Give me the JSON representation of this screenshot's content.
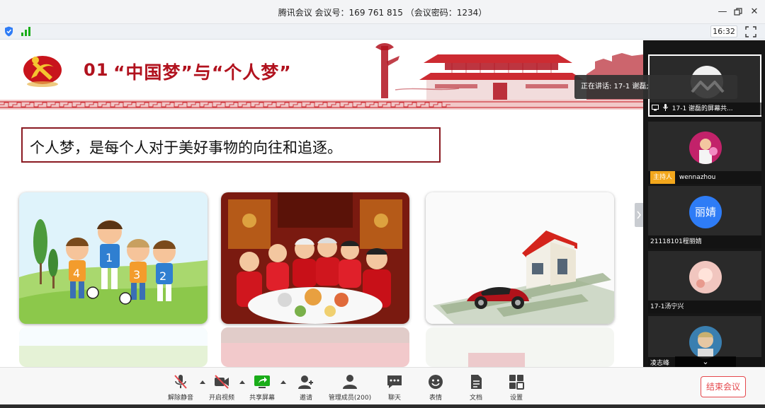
{
  "window": {
    "title": "腾讯会议 会议号：169 761 815 （会议密码：1234）",
    "controls": [
      "minimize-icon",
      "restore-icon",
      "close-icon"
    ]
  },
  "status": {
    "time": "16:32",
    "icons": [
      "shield-icon",
      "signal-icon",
      "fullscreen-icon"
    ]
  },
  "slide": {
    "number": "01",
    "title": "“中国梦”与“个人梦”",
    "quote": "个人梦，是每个人对于美好事物的向往和追逐。",
    "images": [
      "children-soccer-image",
      "family-reunion-dinner-image",
      "house-car-money-image"
    ]
  },
  "participants": {
    "speaking_label": "正在讲话: 17-1  谢磊;",
    "tiles": [
      {
        "name": "17-1  谢磊的屏幕共...",
        "active": true
      },
      {
        "badge": "主持人",
        "name": "wennazhou"
      },
      {
        "avatar_text": "丽婧",
        "name": "21118101程丽婧"
      },
      {
        "name": "17-1汤宁兴"
      },
      {
        "name": "凌志峰"
      }
    ]
  },
  "toolbar": {
    "buttons": [
      {
        "label": "解除静音",
        "icon": "microphone-muted-icon"
      },
      {
        "label": "开启视频",
        "icon": "camera-off-icon"
      },
      {
        "label": "共享屏幕",
        "icon": "screen-share-icon"
      },
      {
        "label": "邀请",
        "icon": "invite-user-icon"
      },
      {
        "label": "管理成员(200)",
        "icon": "members-icon"
      },
      {
        "label": "聊天",
        "icon": "chat-icon"
      },
      {
        "label": "表情",
        "icon": "emoji-icon"
      },
      {
        "label": "文档",
        "icon": "document-icon"
      },
      {
        "label": "设置",
        "icon": "settings-icon"
      }
    ],
    "end_label": "结束会议"
  },
  "colors": {
    "accent_red": "#b1121e",
    "host_badge": "#f3a71c",
    "end_meeting": "#e5484d",
    "active_green": "#1aad19",
    "tencent_blue": "#2e7cf6"
  }
}
